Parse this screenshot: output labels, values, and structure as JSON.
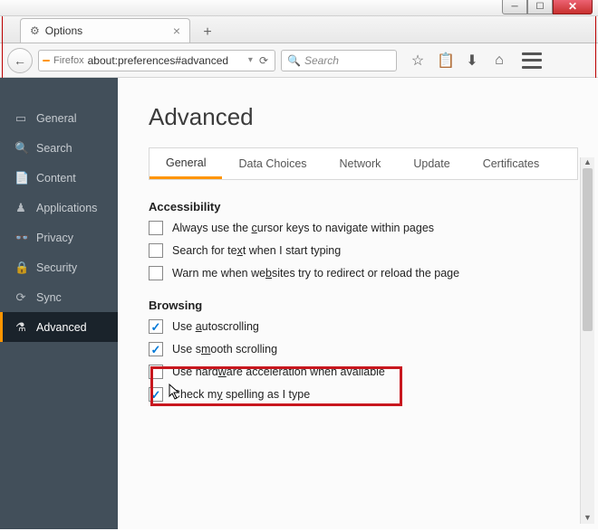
{
  "window": {
    "tab_title": "Options",
    "new_tab_glyph": "+"
  },
  "navbar": {
    "firefox_badge": " ",
    "firefox_label": "Firefox",
    "url": "about:preferences#advanced",
    "search_placeholder": "Search"
  },
  "sidebar": {
    "items": [
      {
        "icon": "▭",
        "label": "General"
      },
      {
        "icon": "🔍",
        "label": "Search"
      },
      {
        "icon": "📄",
        "label": "Content"
      },
      {
        "icon": "♟",
        "label": "Applications"
      },
      {
        "icon": "👓",
        "label": "Privacy"
      },
      {
        "icon": "🔒",
        "label": "Security"
      },
      {
        "icon": "⟳",
        "label": "Sync"
      },
      {
        "icon": "⚗",
        "label": "Advanced"
      }
    ]
  },
  "page": {
    "title": "Advanced",
    "tabs": [
      "General",
      "Data Choices",
      "Network",
      "Update",
      "Certificates"
    ],
    "sections": {
      "accessibility": {
        "heading": "Accessibility",
        "opts": [
          {
            "checked": false,
            "label_pre": "Always use the ",
            "hot": "c",
            "label_post": "ursor keys to navigate within pages"
          },
          {
            "checked": false,
            "label_pre": "Search for te",
            "hot": "x",
            "label_post": "t when I start typing"
          },
          {
            "checked": false,
            "label_pre": "Warn me when we",
            "hot": "b",
            "label_post": "sites try to redirect or reload the page"
          }
        ]
      },
      "browsing": {
        "heading": "Browsing",
        "opts": [
          {
            "checked": true,
            "label_pre": "Use ",
            "hot": "a",
            "label_post": "utoscrolling"
          },
          {
            "checked": true,
            "label_pre": "Use s",
            "hot": "m",
            "label_post": "ooth scrolling"
          },
          {
            "checked": false,
            "label_pre": "Use hard",
            "hot": "w",
            "label_post": "are acceleration when available"
          },
          {
            "checked": true,
            "label_pre": "Check m",
            "hot": "y",
            "label_post": " spelling as I type"
          }
        ]
      }
    }
  }
}
